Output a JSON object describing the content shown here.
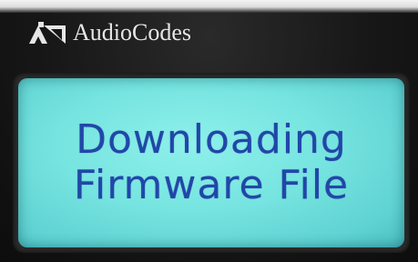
{
  "device": {
    "brand_name": "AudioCodes",
    "logo_icon": "audiocodes-logo-icon"
  },
  "display": {
    "line_1": "Downloading",
    "line_2": "Firmware File"
  },
  "colors": {
    "lcd_background": "#76e4e0",
    "lcd_text": "#2147a8",
    "bezel": "#171717",
    "brand_text": "#e6e6e6"
  }
}
